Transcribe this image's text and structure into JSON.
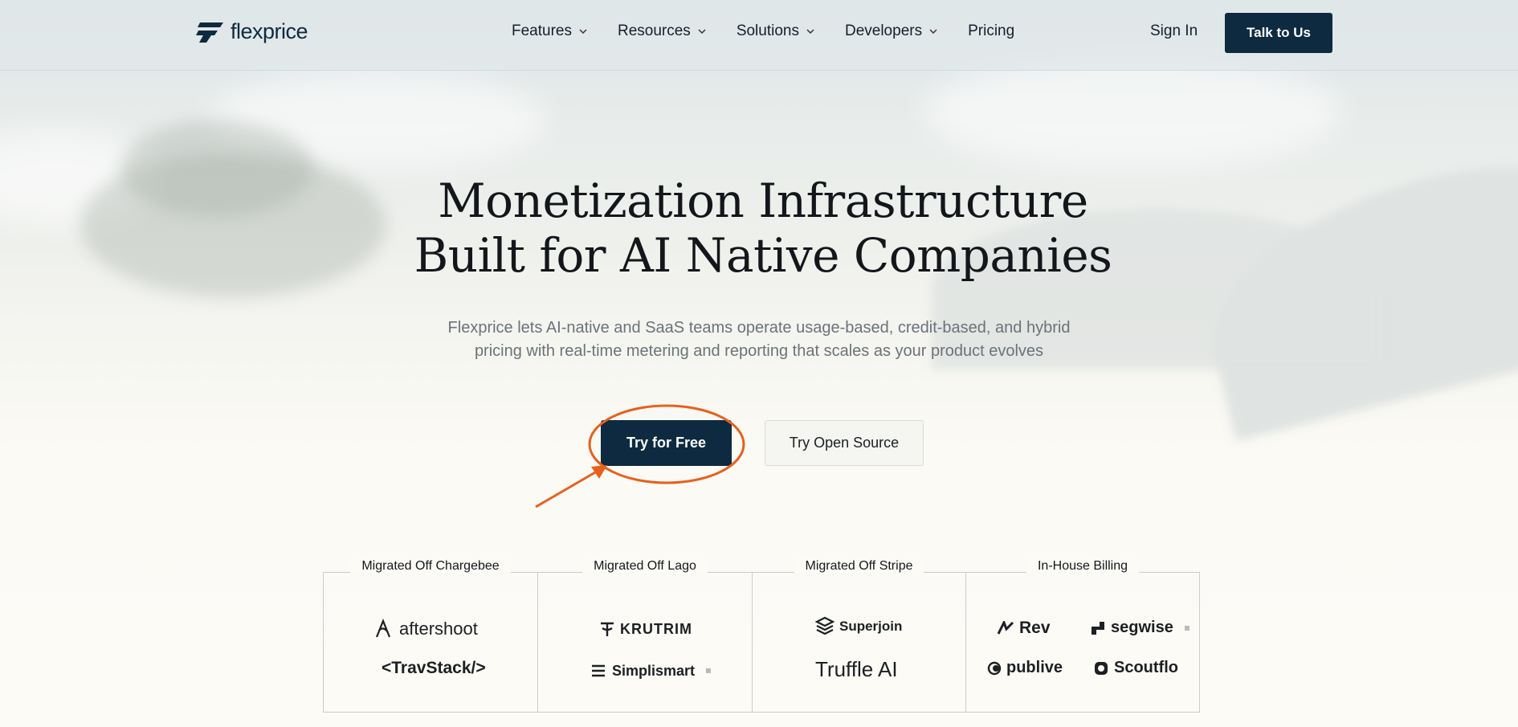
{
  "header": {
    "brand": "flexprice",
    "nav": [
      {
        "label": "Features",
        "has_dropdown": true
      },
      {
        "label": "Resources",
        "has_dropdown": true
      },
      {
        "label": "Solutions",
        "has_dropdown": true
      },
      {
        "label": "Developers",
        "has_dropdown": true
      },
      {
        "label": "Pricing",
        "has_dropdown": false
      }
    ],
    "sign_in": "Sign In",
    "cta": "Talk to Us"
  },
  "hero": {
    "title_line1": "Monetization Infrastructure",
    "title_line2": "Built for AI Native Companies",
    "subtitle_line1": "Flexprice lets AI-native and SaaS teams operate usage-based, credit-based, and hybrid",
    "subtitle_line2": "pricing with real-time metering and reporting that scales as your product evolves",
    "primary_button": "Try for Free",
    "secondary_button": "Try Open Source"
  },
  "logos": {
    "columns": [
      {
        "title": "Migrated Off Chargebee",
        "companies": [
          "aftershoot",
          "<TravStack/>"
        ]
      },
      {
        "title": "Migrated Off Lago",
        "companies": [
          "KRUTRIM",
          "Simplismart"
        ]
      },
      {
        "title": "Migrated Off Stripe",
        "companies": [
          "Superjoin",
          "Truffle AI"
        ]
      },
      {
        "title": "In-House Billing",
        "companies": [
          "Rev",
          "segwise",
          "publive",
          "Scoutflo"
        ]
      }
    ]
  },
  "colors": {
    "brand_navy": "#0d2a40",
    "annotation_orange": "#e8601c"
  }
}
